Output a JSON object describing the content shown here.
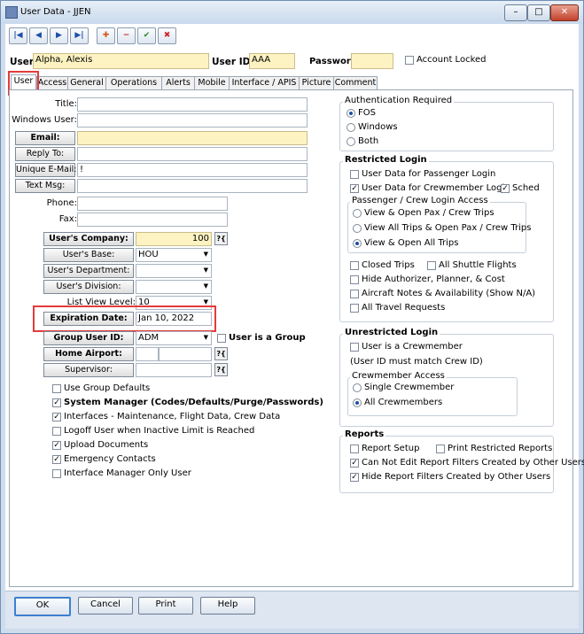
{
  "window": {
    "title": "User Data - JJEN",
    "min": "–",
    "max": "□",
    "close": "✕"
  },
  "toolbar": {
    "first": "|◀",
    "prev": "◀",
    "next": "▶",
    "last": "▶|",
    "add": "✚",
    "delete": "−",
    "confirm": "✔",
    "cancel": "✖"
  },
  "header": {
    "user_label": "User:",
    "user_value": "Alpha, Alexis",
    "userid_label": "User ID:",
    "userid_value": "AAA",
    "password_label": "Password:",
    "password_value": "",
    "account_locked": "Account Locked"
  },
  "tabs": [
    "User",
    "Access",
    "General",
    "Operations",
    "Alerts",
    "Mobile",
    "Interface / APIS",
    "Picture",
    "Comment"
  ],
  "left": {
    "title": "Title:",
    "windows_user": "Windows User:",
    "email": "Email:",
    "reply_to": "Reply To:",
    "unique_email": "Unique E-Mail:",
    "unique_email_value": "!",
    "text_msg": "Text Msg:",
    "phone": "Phone:",
    "fax": "Fax:",
    "users_company": "User's Company:",
    "users_company_value": "100",
    "users_base": "User's Base:",
    "users_base_value": "HOU",
    "users_department": "User's Department:",
    "users_division": "User's Division:",
    "list_view_level": "List View Level:",
    "list_view_level_value": "10",
    "expiration_date": "Expiration Date:",
    "expiration_date_value": "Jan 10, 2022",
    "group_user_id": "Group User ID:",
    "group_user_id_value": "ADM",
    "user_is_group": "User is a Group",
    "home_airport": "Home Airport:",
    "supervisor": "Supervisor:",
    "q_label": "?{"
  },
  "checks": {
    "use_group_defaults": "Use Group Defaults",
    "system_manager": "System Manager (Codes/Defaults/Purge/Passwords)",
    "interfaces": "Interfaces - Maintenance, Flight Data, Crew Data",
    "logoff": "Logoff User when Inactive Limit is Reached",
    "upload_documents": "Upload Documents",
    "emergency_contacts": "Emergency Contacts",
    "interface_manager": "Interface Manager Only User"
  },
  "auth": {
    "title": "Authentication Required",
    "fos": "FOS",
    "windows": "Windows",
    "both": "Both"
  },
  "restricted": {
    "title": "Restricted Login",
    "passenger_login": "User Data for Passenger Login",
    "crewmember_login": "User Data for Crewmember Login",
    "sched": "Sched",
    "access_title": "Passenger / Crew Login Access",
    "view_open_pax": "View & Open Pax / Crew Trips",
    "view_all_open_pax": "View All Trips & Open Pax / Crew Trips",
    "view_open_all": "View & Open All Trips",
    "closed_trips": "Closed Trips",
    "all_shuttle": "All Shuttle Flights",
    "hide_authorizer": "Hide Authorizer, Planner, & Cost",
    "aircraft_notes": "Aircraft Notes & Availability (Show N/A)",
    "all_travel": "All Travel Requests"
  },
  "unrestricted": {
    "title": "Unrestricted Login",
    "is_crewmember": "User is a Crewmember",
    "note": "(User ID must match Crew ID)",
    "crew_access_title": "Crewmember Access",
    "single": "Single Crewmember",
    "all": "All Crewmembers"
  },
  "reports": {
    "title": "Reports",
    "setup": "Report Setup",
    "print_restricted": "Print Restricted Reports",
    "cannot_edit": "Can Not Edit Report Filters Created by Other Users",
    "hide_filters": "Hide Report Filters Created by Other Users"
  },
  "bottom": {
    "ok": "OK",
    "cancel": "Cancel",
    "print": "Print",
    "help": "Help"
  },
  "colors": {
    "highlight_red": "#e33b3b",
    "yellow_field": "#fdf3c2"
  }
}
